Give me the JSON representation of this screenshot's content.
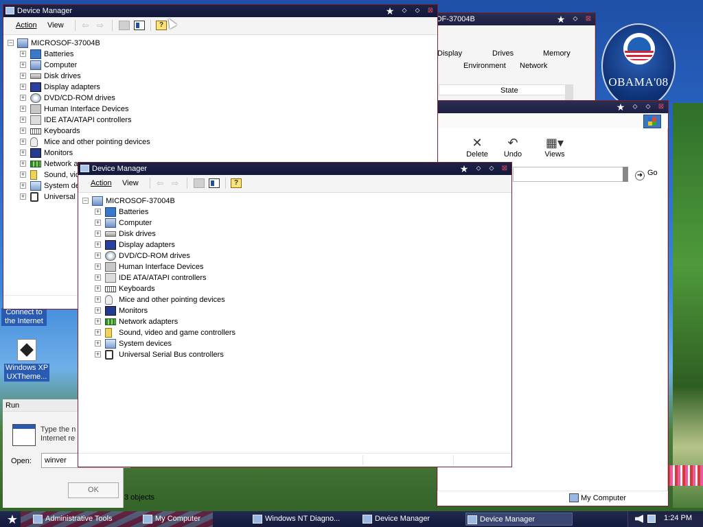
{
  "desktop": {
    "logo_text": "OBAMA'08",
    "icons": [
      {
        "label": "Connect to the Internet"
      },
      {
        "label": "Windows XP UXTheme..."
      }
    ]
  },
  "props_window": {
    "title": "OF-37004B",
    "tabs_row1": [
      "Display",
      "Drives",
      "Memory"
    ],
    "tabs_row2": [
      "Environment",
      "Network"
    ],
    "column_state": "State"
  },
  "explorer_window": {
    "buttons": {
      "delete": "Delete",
      "undo": "Undo",
      "views": "Views"
    },
    "go_label": "Go",
    "status_objects": "3 objects",
    "status_location": "My Computer"
  },
  "dm_back": {
    "title": "Device Manager",
    "menu": {
      "action": "Action",
      "view": "View"
    },
    "root": "MICROSOF-37004B",
    "items": [
      "Batteries",
      "Computer",
      "Disk drives",
      "Display adapters",
      "DVD/CD-ROM drives",
      "Human Interface Devices",
      "IDE ATA/ATAPI controllers",
      "Keyboards",
      "Mice and other pointing devices",
      "Monitors",
      "Network a",
      "Sound, vid",
      "System de",
      "Universal"
    ]
  },
  "dm_front": {
    "title": "Device Manager",
    "menu": {
      "action": "Action",
      "view": "View"
    },
    "root": "MICROSOF-37004B",
    "items": [
      "Batteries",
      "Computer",
      "Disk drives",
      "Display adapters",
      "DVD/CD-ROM drives",
      "Human Interface Devices",
      "IDE ATA/ATAPI controllers",
      "Keyboards",
      "Mice and other pointing devices",
      "Monitors",
      "Network adapters",
      "Sound, video and game controllers",
      "System devices",
      "Universal Serial Bus controllers"
    ]
  },
  "run_dialog": {
    "title": "Run",
    "text_line1": "Type the n",
    "text_line2": "Internet re",
    "open_label": "Open:",
    "open_value": "winver",
    "ok_label": "OK"
  },
  "taskbar": {
    "items": [
      "Administrative Tools",
      "My Computer",
      "Windows NT Diagno...",
      "Device Manager",
      "Device Manager"
    ],
    "clock": "1:24 PM"
  }
}
